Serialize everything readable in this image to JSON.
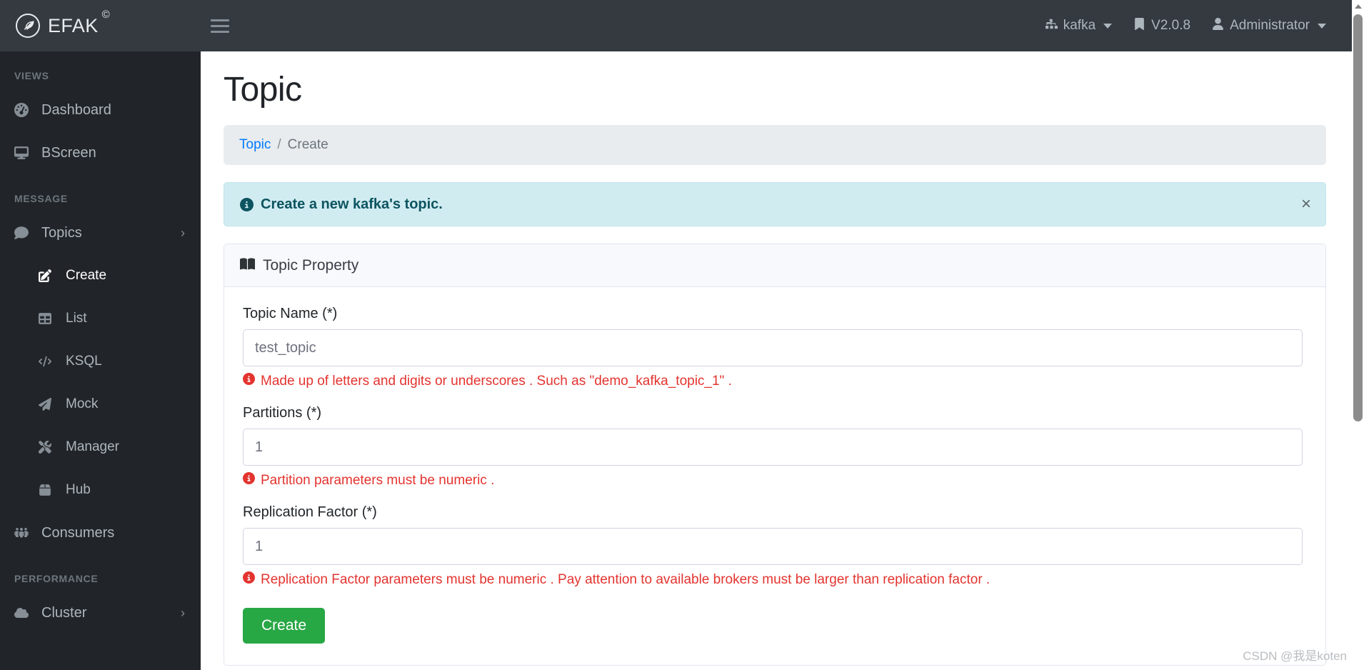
{
  "topbar": {
    "brand_name": "EFAK",
    "brand_sup": "©",
    "logo_icon": "feather-circle-icon",
    "menu_toggle_icon": "hamburger-icon",
    "cluster": {
      "label": "kafka",
      "icon": "sitemap-icon"
    },
    "version": {
      "label": "V2.0.8",
      "icon": "bookmark-icon"
    },
    "user": {
      "label": "Administrator",
      "icon": "user-icon"
    }
  },
  "sidebar": {
    "groups": [
      {
        "heading": "VIEWS",
        "items": [
          {
            "label": "Dashboard",
            "icon": "tachometer-icon",
            "active": false,
            "sub": false,
            "chevron": ""
          },
          {
            "label": "BScreen",
            "icon": "desktop-icon",
            "active": false,
            "sub": false,
            "chevron": ""
          }
        ]
      },
      {
        "heading": "MESSAGE",
        "items": [
          {
            "label": "Topics",
            "icon": "comment-icon",
            "active": false,
            "sub": false,
            "chevron": "›"
          },
          {
            "label": "Create",
            "icon": "edit-square-icon",
            "active": true,
            "sub": true,
            "chevron": ""
          },
          {
            "label": "List",
            "icon": "table-icon",
            "active": false,
            "sub": true,
            "chevron": ""
          },
          {
            "label": "KSQL",
            "icon": "code-icon",
            "active": false,
            "sub": true,
            "chevron": ""
          },
          {
            "label": "Mock",
            "icon": "paper-plane-icon",
            "active": false,
            "sub": true,
            "chevron": ""
          },
          {
            "label": "Manager",
            "icon": "tools-icon",
            "active": false,
            "sub": true,
            "chevron": ""
          },
          {
            "label": "Hub",
            "icon": "box-icon",
            "active": false,
            "sub": true,
            "chevron": ""
          },
          {
            "label": "Consumers",
            "icon": "users-icon",
            "active": false,
            "sub": false,
            "chevron": ""
          }
        ]
      },
      {
        "heading": "PERFORMANCE",
        "items": [
          {
            "label": "Cluster",
            "icon": "cloud-icon",
            "active": false,
            "sub": false,
            "chevron": "›"
          }
        ]
      }
    ]
  },
  "main": {
    "page_title": "Topic",
    "breadcrumb": {
      "link": "Topic",
      "separator": "/",
      "current": "Create"
    },
    "alert": {
      "text": "Create a new kafka's topic.",
      "close_label": "×",
      "icon": "info-circle-icon"
    },
    "card": {
      "title": "Topic Property",
      "icon": "book-open-icon",
      "fields": [
        {
          "label": "Topic Name (*)",
          "value": "test_topic",
          "placeholder": "",
          "help": "Made up of letters and digits or underscores . Such as \"demo_kafka_topic_1\" ."
        },
        {
          "label": "Partitions (*)",
          "value": "1",
          "placeholder": "",
          "help": "Partition parameters must be numeric ."
        },
        {
          "label": "Replication Factor (*)",
          "value": "1",
          "placeholder": "",
          "help": "Replication Factor parameters must be numeric . Pay attention to available brokers must be larger than replication factor ."
        }
      ],
      "submit_label": "Create"
    }
  },
  "watermark": "CSDN @我是koten",
  "colors": {
    "topbar_bg": "#343a40",
    "sidebar_bg": "#212529",
    "accent_link": "#007bff",
    "alert_bg": "#d1ecf1",
    "alert_text": "#0c5460",
    "error_text": "#e3342f",
    "submit_bg": "#28a745"
  }
}
